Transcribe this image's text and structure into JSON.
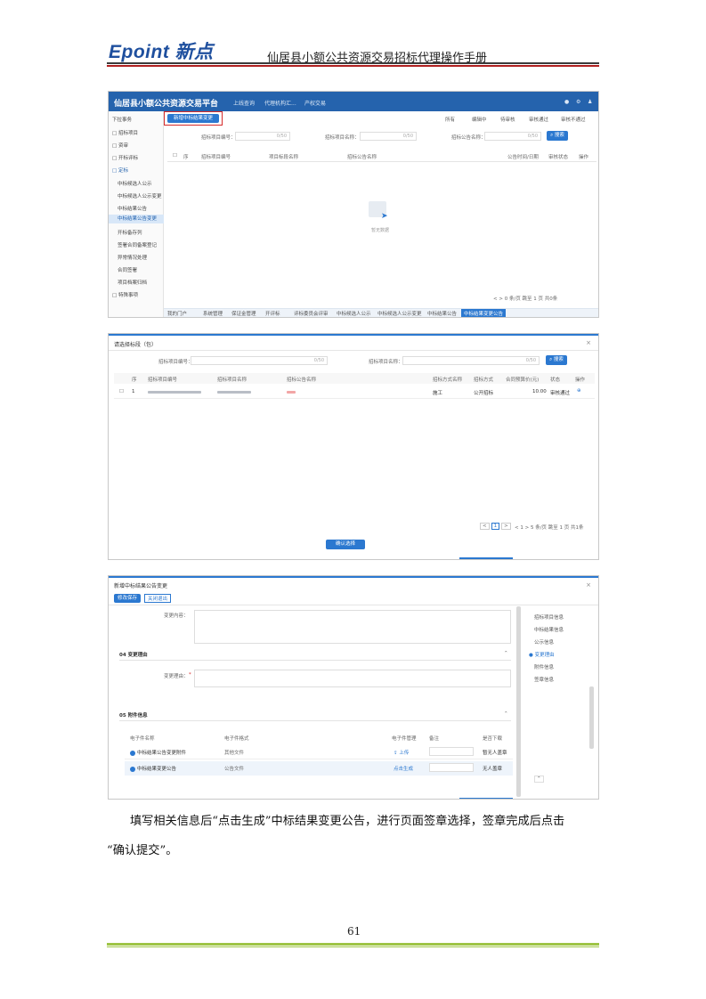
{
  "header": {
    "logo": "Epoint 新点",
    "manual_title": "仙居县小额公共资源交易招标代理操作手册"
  },
  "screenshot1": {
    "app_title": "仙居县小额公共资源交易平台",
    "top_menu": [
      "上线查询",
      "代理机构汇...",
      "产权交易"
    ],
    "sidebar": [
      "下拉事务",
      "□ 招标项目",
      "□ 资审",
      "□ 开标评标",
      "□ 定标",
      "中标候选人公示",
      "中标候选人公示变更",
      "中标结果公告",
      "中标结果公告变更",
      "开标备存列",
      "签署合同备案登记",
      "异常情况处理",
      "合同签署",
      "项目档案归档",
      "□ 特殊事项"
    ],
    "new_button": "新增中标结果变更",
    "radios": [
      "所有",
      "编辑中",
      "待审核",
      "审核通过",
      "审核不通过"
    ],
    "filters": [
      {
        "label": "招标项目编号：",
        "counter": "0/50"
      },
      {
        "label": "招标项目名称：",
        "counter": "0/50"
      },
      {
        "label": "招标公告名称：",
        "counter": "0/50"
      }
    ],
    "search_button": "搜索",
    "columns": [
      "序",
      "招标项目编号",
      "项目标段名称",
      "招标公告名称",
      "公告时间/日期",
      "审核状态",
      "操作"
    ],
    "empty_text": "暂无数据",
    "pager": "< > 0 条/页 跳至 1 页 共0条",
    "bottom_tabs": [
      "我的门户",
      "系统管理",
      "保证金管理",
      "开评标",
      "评标委员会评审",
      "中标候选人公示",
      "中标候选人公示变更",
      "中标结果公告",
      "中标结果变更公告"
    ]
  },
  "screenshot2": {
    "title": "请选择标段（包）",
    "filters": [
      {
        "label": "招标项目编号：",
        "counter": "0/50"
      },
      {
        "label": "招标项目名称：",
        "counter": "0/50"
      }
    ],
    "search_button": "搜索",
    "columns": [
      "序",
      "招标项目编号",
      "招标项目名称",
      "招标公告名称",
      "招标方式名称",
      "招标方式",
      "合同预算价(元)",
      "状态",
      "操作"
    ],
    "row": {
      "index": "1",
      "bid_type": "施工",
      "method": "公开招标",
      "price": "10.00",
      "status": "审核通过"
    },
    "pager": "< 1 > 5 条/页 跳至 1 页 共1条",
    "confirm_button": "确认选择"
  },
  "screenshot3": {
    "title": "新增中标结果公告变更",
    "tabs": [
      "修改保存",
      "关闭退出"
    ],
    "field_top": "变更内容：",
    "section4": "04  变更理由",
    "field_reason": "变更理由：",
    "section5": "05  附件信息",
    "attach_columns": [
      "电子件名称",
      "电子件格式",
      "电子件管理",
      "备注",
      "是否下载"
    ],
    "attach_rows": [
      {
        "name": "中标结果公告变更附件",
        "format": "其他文件",
        "action": "上传",
        "extra": "暂无人盖章"
      },
      {
        "name": "中标结果变更公告",
        "format": "公告文件",
        "action": "点击生成",
        "extra": "无人盖章"
      }
    ],
    "toc": [
      "招标项目信息",
      "中标结果信息",
      "公示信息",
      "变更理由",
      "附件信息",
      "签章信息"
    ]
  },
  "caption": {
    "line1": "填写相关信息后“点击生成”中标结果变更公告，进行页面签章选择，签章完成后点击",
    "line2": "“确认提交”。"
  },
  "page_number": "61"
}
